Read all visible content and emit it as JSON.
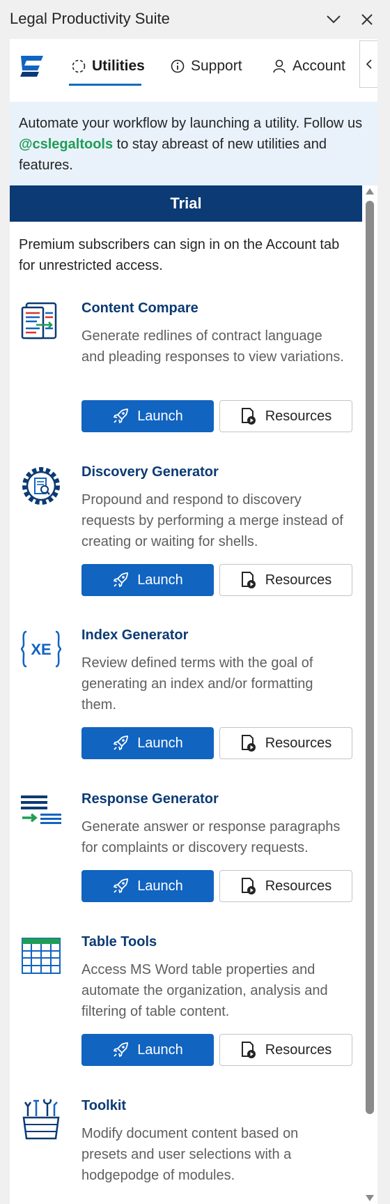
{
  "window": {
    "title": "Legal Productivity Suite"
  },
  "tabs": [
    {
      "label": "Utilities",
      "icon": "loading-icon",
      "active": true
    },
    {
      "label": "Support",
      "icon": "info-icon"
    },
    {
      "label": "Account",
      "icon": "person-icon"
    }
  ],
  "notice": {
    "before": "Automate your workflow by launching a utility. Follow us ",
    "handle": "@cslegaltools",
    "after": " to stay abreast of new utilities and features."
  },
  "plan": {
    "label": "Trial"
  },
  "intro": "Premium subscribers can sign in on the Account tab for unrestricted access.",
  "buttons": {
    "launch": "Launch",
    "resources": "Resources"
  },
  "utilities": [
    {
      "title": "Content Compare",
      "description": "Generate redlines of contract language and pleading responses to view variations.",
      "icon": "compare-documents-icon"
    },
    {
      "title": "Discovery Generator",
      "description": "Propound and respond to discovery requests by performing a merge instead of creating or waiting for shells.",
      "icon": "gear-document-icon"
    },
    {
      "title": "Index Generator",
      "description": "Review defined terms with the goal of generating an index and/or formatting them.",
      "icon": "xe-braces-icon",
      "icon_text": "XE"
    },
    {
      "title": "Response Generator",
      "description": "Generate answer or response paragraphs for complaints or discovery requests.",
      "icon": "text-lines-arrow-icon"
    },
    {
      "title": "Table Tools",
      "description": "Access MS Word table properties and automate the organization, analysis and filtering of table content.",
      "icon": "table-grid-icon"
    },
    {
      "title": "Toolkit",
      "description": "Modify document content based on presets and user selections with a hodgepodge of modules.",
      "icon": "toolbox-icon"
    }
  ],
  "colors": {
    "brand": "#0b3a74",
    "accent": "#1164c0",
    "handle": "#1f9d55",
    "notice_bg": "#e9f2fb"
  }
}
